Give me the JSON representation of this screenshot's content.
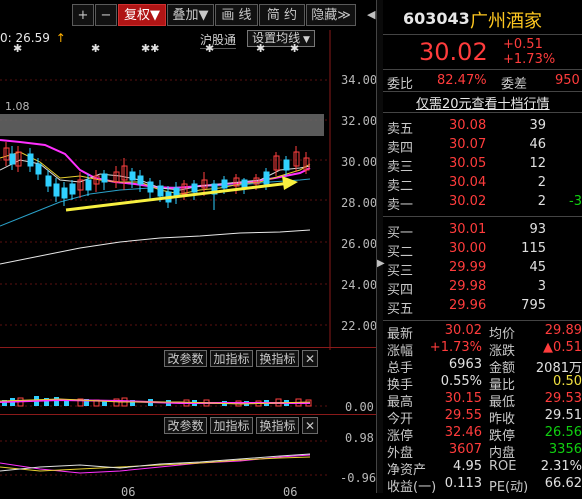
{
  "toolbar": {
    "plus": "+",
    "minus": "−",
    "fuquan": "复权▼",
    "diejia": "叠加▼",
    "huaxian": "画 线",
    "jianyue": "简 约",
    "yincang": "隐藏≫"
  },
  "chart": {
    "ma_label": "0: 26.59",
    "ma_arrow": "↑",
    "small_label": "1.08",
    "hugutong": "沪股通",
    "shezhi": "设置均线",
    "price_axis": [
      "34.00",
      "32.00",
      "30.00",
      "28.00",
      "26.00",
      "24.00",
      "22.00"
    ],
    "vol_axis": "0.00",
    "ind_axis": [
      "0.98",
      "-0.96"
    ],
    "bottom_dates": [
      "06",
      "06"
    ],
    "gaicanshu": "改参数",
    "jiazhibiao": "加指标",
    "huanzhibiao": "换指标",
    "close": "✕"
  },
  "quote": {
    "code": "603043",
    "name": "广州酒家",
    "price": "30.02",
    "change": "+0.51",
    "change_pct": "+1.73%",
    "weibi_label": "委比",
    "weibi_value": "82.47%",
    "weicha_label": "委差",
    "weicha_value": "950",
    "promo": "仅需20元查看十档行情"
  },
  "order_book": {
    "sells": [
      {
        "label": "卖五",
        "price": "30.08",
        "vol": "39"
      },
      {
        "label": "卖四",
        "price": "30.07",
        "vol": "46"
      },
      {
        "label": "卖三",
        "price": "30.05",
        "vol": "12"
      },
      {
        "label": "卖二",
        "price": "30.04",
        "vol": "2"
      },
      {
        "label": "卖一",
        "price": "30.02",
        "vol": "2",
        "extra": "-3"
      }
    ],
    "buys": [
      {
        "label": "买一",
        "price": "30.01",
        "vol": "93"
      },
      {
        "label": "买二",
        "price": "30.00",
        "vol": "115"
      },
      {
        "label": "买三",
        "price": "29.99",
        "vol": "45"
      },
      {
        "label": "买四",
        "price": "29.98",
        "vol": "3"
      },
      {
        "label": "买五",
        "price": "29.96",
        "vol": "795"
      }
    ]
  },
  "stats": [
    {
      "l1": "最新",
      "v1": "30.02",
      "c1": "red",
      "l2": "均价",
      "v2": "29.89",
      "c2": "red"
    },
    {
      "l1": "涨幅",
      "v1": "+1.73%",
      "c1": "red",
      "l2": "涨跌",
      "v2": "▲0.51",
      "c2": "red"
    },
    {
      "l1": "总手",
      "v1": "6963",
      "c1": "wht",
      "l2": "金额",
      "v2": "2081万",
      "c2": "wht"
    },
    {
      "l1": "换手",
      "v1": "0.55%",
      "c1": "wht",
      "l2": "量比",
      "v2": "0.50",
      "c2": "yel"
    },
    {
      "l1": "最高",
      "v1": "30.15",
      "c1": "red",
      "l2": "最低",
      "v2": "29.53",
      "c2": "red"
    },
    {
      "l1": "今开",
      "v1": "29.55",
      "c1": "red",
      "l2": "昨收",
      "v2": "29.51",
      "c2": "wht"
    },
    {
      "l1": "涨停",
      "v1": "32.46",
      "c1": "red",
      "l2": "跌停",
      "v2": "26.56",
      "c2": "grn"
    },
    {
      "l1": "外盘",
      "v1": "3607",
      "c1": "red",
      "l2": "内盘",
      "v2": "3356",
      "c2": "grn"
    },
    {
      "l1": "净资产",
      "v1": "4.95",
      "c1": "wht",
      "l2": "ROE",
      "v2": "2.31%",
      "c2": "wht"
    },
    {
      "l1": "收益(一)",
      "v1": "0.113",
      "c1": "wht",
      "l2": "PE(动)",
      "v2": "66.62",
      "c2": "wht"
    }
  ]
}
